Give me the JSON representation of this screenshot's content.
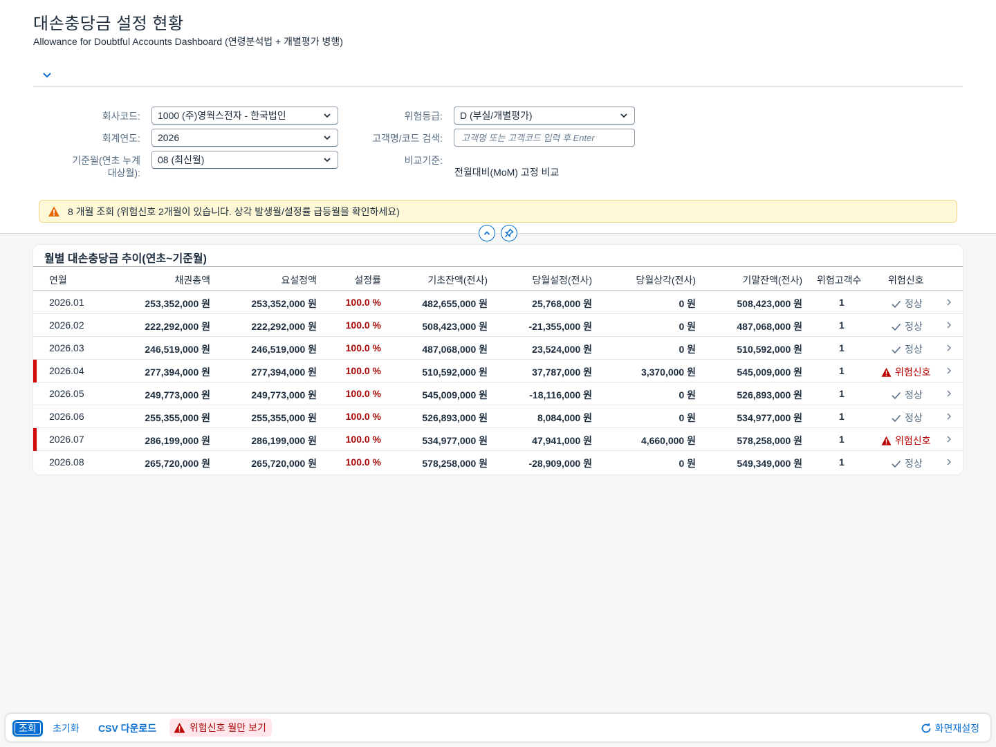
{
  "header": {
    "title": "대손충당금 설정 현황",
    "subtitle": "Allowance for Doubtful Accounts Dashboard (연령분석법 + 개별평가 병행)"
  },
  "filters": {
    "company_label": "회사코드:",
    "company_value": "1000 (주)영웍스전자 - 한국법인",
    "year_label": "회계연도:",
    "year_value": "2026",
    "month_label_line1": "기준월(연초 누계",
    "month_label_line2": "대상월):",
    "month_value": "08 (최신월)",
    "risk_label": "위험등급:",
    "risk_value": "D (부실/개별평가)",
    "search_label": "고객명/코드 검색:",
    "search_placeholder": "고객명 또는 고객코드 입력 후 Enter",
    "search_value": "",
    "compare_label": "비교기준:",
    "compare_value": "전월대비(MoM) 고정 비교"
  },
  "message_strip": {
    "type": "warning",
    "text": "8 개월 조회 (위험신호 2개월이 있습니다. 상각 발생월/설정률 급등월을 확인하세요)"
  },
  "table": {
    "title": "월별 대손충당금 추이(연초~기준월)",
    "columns": [
      "연월",
      "채권총액",
      "요설정액",
      "설정률",
      "기초잔액(전사)",
      "당월설정(전사)",
      "당월상각(전사)",
      "기말잔액(전사)",
      "위험고객수",
      "위험신호"
    ],
    "rows": [
      {
        "ym": "2026.01",
        "receivable": "253,352,000 원",
        "required": "253,352,000 원",
        "rate": "100.0 %",
        "opening": "482,655,000 원",
        "provision": "25,768,000 원",
        "writeoff": "0 원",
        "closing": "508,423,000 원",
        "risk_count": "1",
        "signal": "정상",
        "alert": false
      },
      {
        "ym": "2026.02",
        "receivable": "222,292,000 원",
        "required": "222,292,000 원",
        "rate": "100.0 %",
        "opening": "508,423,000 원",
        "provision": "-21,355,000 원",
        "writeoff": "0 원",
        "closing": "487,068,000 원",
        "risk_count": "1",
        "signal": "정상",
        "alert": false
      },
      {
        "ym": "2026.03",
        "receivable": "246,519,000 원",
        "required": "246,519,000 원",
        "rate": "100.0 %",
        "opening": "487,068,000 원",
        "provision": "23,524,000 원",
        "writeoff": "0 원",
        "closing": "510,592,000 원",
        "risk_count": "1",
        "signal": "정상",
        "alert": false
      },
      {
        "ym": "2026.04",
        "receivable": "277,394,000 원",
        "required": "277,394,000 원",
        "rate": "100.0 %",
        "opening": "510,592,000 원",
        "provision": "37,787,000 원",
        "writeoff": "3,370,000 원",
        "closing": "545,009,000 원",
        "risk_count": "1",
        "signal": "위험신호",
        "alert": true
      },
      {
        "ym": "2026.05",
        "receivable": "249,773,000 원",
        "required": "249,773,000 원",
        "rate": "100.0 %",
        "opening": "545,009,000 원",
        "provision": "-18,116,000 원",
        "writeoff": "0 원",
        "closing": "526,893,000 원",
        "risk_count": "1",
        "signal": "정상",
        "alert": false
      },
      {
        "ym": "2026.06",
        "receivable": "255,355,000 원",
        "required": "255,355,000 원",
        "rate": "100.0 %",
        "opening": "526,893,000 원",
        "provision": "8,084,000 원",
        "writeoff": "0 원",
        "closing": "534,977,000 원",
        "risk_count": "1",
        "signal": "정상",
        "alert": false
      },
      {
        "ym": "2026.07",
        "receivable": "286,199,000 원",
        "required": "286,199,000 원",
        "rate": "100.0 %",
        "opening": "534,977,000 원",
        "provision": "47,941,000 원",
        "writeoff": "4,660,000 원",
        "closing": "578,258,000 원",
        "risk_count": "1",
        "signal": "위험신호",
        "alert": true
      },
      {
        "ym": "2026.08",
        "receivable": "265,720,000 원",
        "required": "265,720,000 원",
        "rate": "100.0 %",
        "opening": "578,258,000 원",
        "provision": "-28,909,000 원",
        "writeoff": "0 원",
        "closing": "549,349,000 원",
        "risk_count": "1",
        "signal": "정상",
        "alert": false
      }
    ]
  },
  "footer": {
    "search_button": "조회",
    "reset_button": "초기화",
    "csv_button": "CSV 다운로드",
    "risk_only_button": "위험신호 월만 보기",
    "refresh_button": "화면재설정"
  },
  "colors": {
    "accent": "#0a6ed1",
    "danger": "#bb0000",
    "warning_bg": "#fff8d6",
    "row_alert_bar": "#d20a0a"
  }
}
